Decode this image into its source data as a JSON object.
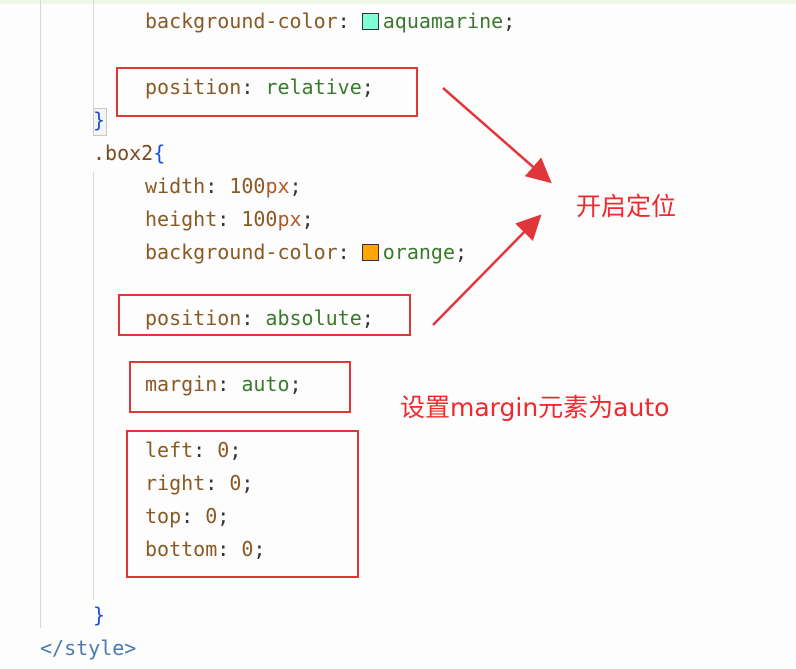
{
  "code": {
    "aqua_prop": "background-color",
    "aqua_value": "aquamarine",
    "rel_prop": "position",
    "rel_value": "relative",
    "close_brace": "}",
    "box2_selector": ".box2",
    "open_brace": "{",
    "width_prop": "width",
    "width_num": "100",
    "width_unit": "px",
    "height_prop": "height",
    "height_num": "100",
    "height_unit": "px",
    "orange_prop": "background-color",
    "orange_value": "orange",
    "abs_prop": "position",
    "abs_value": "absolute",
    "margin_prop": "margin",
    "margin_value": "auto",
    "left_prop": "left",
    "left_value": "0",
    "right_prop": "right",
    "right_value": "0",
    "top_prop": "top",
    "top_value": "0",
    "bottom_prop": "bottom",
    "bottom_value": "0",
    "end_brace": "}",
    "style_close": "</style>"
  },
  "colors": {
    "aquamarine_swatch": "#7fffd4",
    "orange_swatch": "#ffa500",
    "annotation_red": "#e0363a"
  },
  "annotations": {
    "enable_positioning": "开启定位",
    "set_margin_auto": "设置margin元素为auto"
  }
}
